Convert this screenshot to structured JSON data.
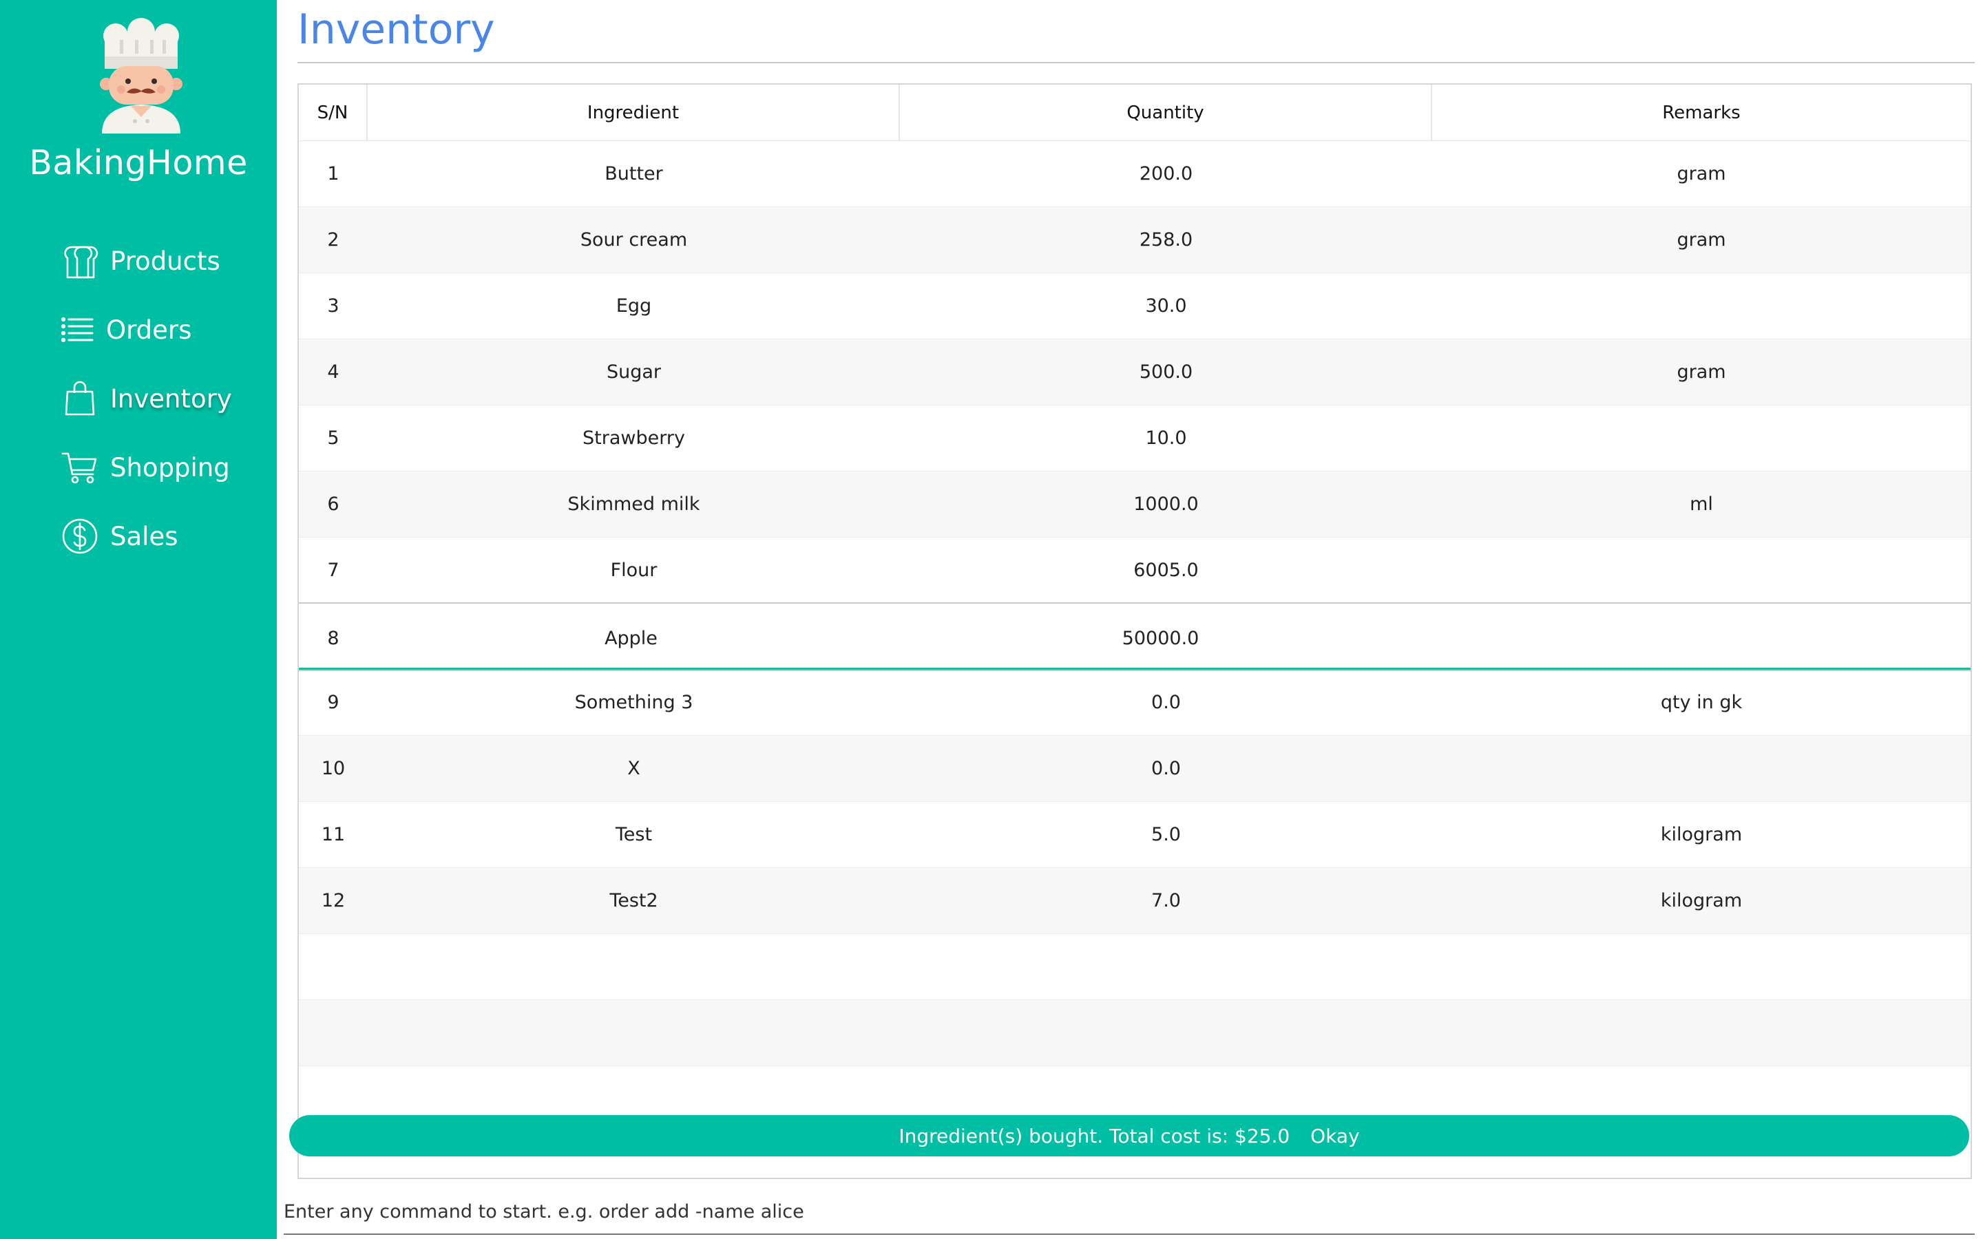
{
  "sidebar": {
    "brand": "BakingHome",
    "items": [
      {
        "label": "Products",
        "icon": "bread-icon"
      },
      {
        "label": "Orders",
        "icon": "list-icon"
      },
      {
        "label": "Inventory",
        "icon": "shopping-bag-icon"
      },
      {
        "label": "Shopping",
        "icon": "cart-icon"
      },
      {
        "label": "Sales",
        "icon": "dollar-icon"
      }
    ],
    "active": "Inventory"
  },
  "page": {
    "title": "Inventory"
  },
  "table": {
    "headers": {
      "sn": "S/N",
      "ingredient": "Ingredient",
      "quantity": "Quantity",
      "remarks": "Remarks"
    },
    "rows": [
      {
        "sn": "1",
        "ingredient": "Butter",
        "quantity": "200.0",
        "remarks": "gram"
      },
      {
        "sn": "2",
        "ingredient": "Sour cream",
        "quantity": "258.0",
        "remarks": "gram"
      },
      {
        "sn": "3",
        "ingredient": "Egg",
        "quantity": "30.0",
        "remarks": ""
      },
      {
        "sn": "4",
        "ingredient": "Sugar",
        "quantity": "500.0",
        "remarks": "gram"
      },
      {
        "sn": "5",
        "ingredient": "Strawberry",
        "quantity": "10.0",
        "remarks": ""
      },
      {
        "sn": "6",
        "ingredient": "Skimmed milk",
        "quantity": "1000.0",
        "remarks": "ml"
      },
      {
        "sn": "7",
        "ingredient": "Flour",
        "quantity": "6005.0",
        "remarks": ""
      },
      {
        "sn": "8",
        "ingredient": "Apple",
        "quantity": "50000.0",
        "remarks": ""
      },
      {
        "sn": "9",
        "ingredient": "Something 3",
        "quantity": "0.0",
        "remarks": "qty in gk"
      },
      {
        "sn": "10",
        "ingredient": "X",
        "quantity": "0.0",
        "remarks": ""
      },
      {
        "sn": "11",
        "ingredient": "Test",
        "quantity": "5.0",
        "remarks": "kilogram"
      },
      {
        "sn": "12",
        "ingredient": "Test2",
        "quantity": "7.0",
        "remarks": "kilogram"
      }
    ],
    "selected_sn": "8"
  },
  "notification": {
    "message": "Ingredient(s) bought. Total cost is: $25.0",
    "action": "Okay"
  },
  "command": {
    "placeholder": "Enter any command to start. e.g. order add -name alice"
  },
  "colors": {
    "sidebar": "#00bea3",
    "title": "#4a86e8",
    "selected_underline": "#1fb89f"
  }
}
